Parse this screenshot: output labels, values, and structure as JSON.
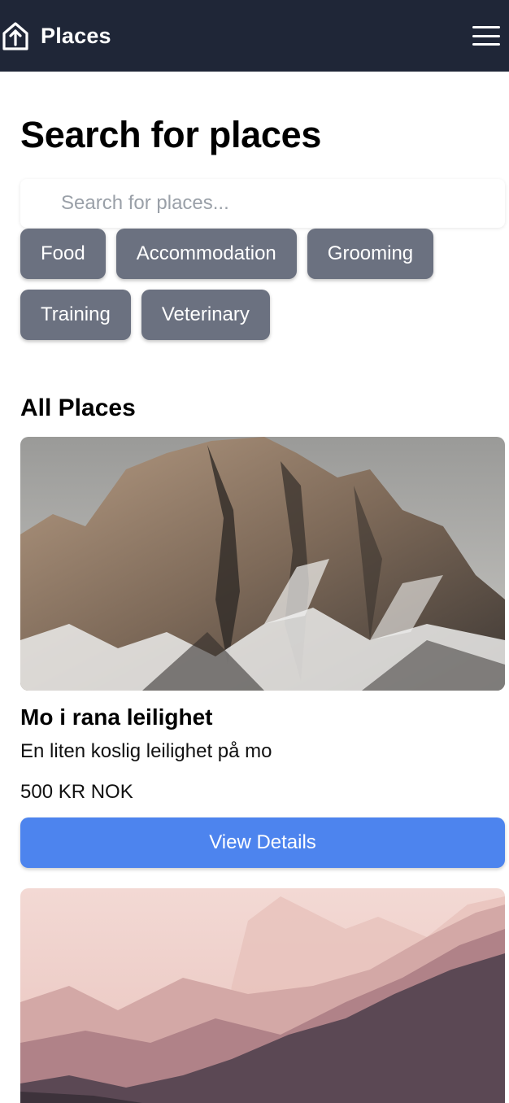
{
  "header": {
    "title": "Places",
    "logo_icon": "house-upload-icon",
    "menu_icon": "hamburger-menu-icon",
    "background": "#1f2637"
  },
  "search": {
    "heading": "Search for places",
    "placeholder": "Search for places...",
    "value": ""
  },
  "categories": [
    {
      "label": "Food"
    },
    {
      "label": "Accommodation"
    },
    {
      "label": "Grooming"
    },
    {
      "label": "Training"
    },
    {
      "label": "Veterinary"
    }
  ],
  "places_section": {
    "heading": "All Places"
  },
  "places": [
    {
      "image": "snowy-rock-mountain-photo",
      "name": "Mo i rana leilighet",
      "description": "En liten koslig leilighet på mo",
      "price": "500 KR NOK",
      "button_label": "View Details"
    },
    {
      "image": "pink-misty-mountains-photo"
    }
  ],
  "colors": {
    "filter_button": "#6b7180",
    "primary_button": "#4d84ee"
  }
}
